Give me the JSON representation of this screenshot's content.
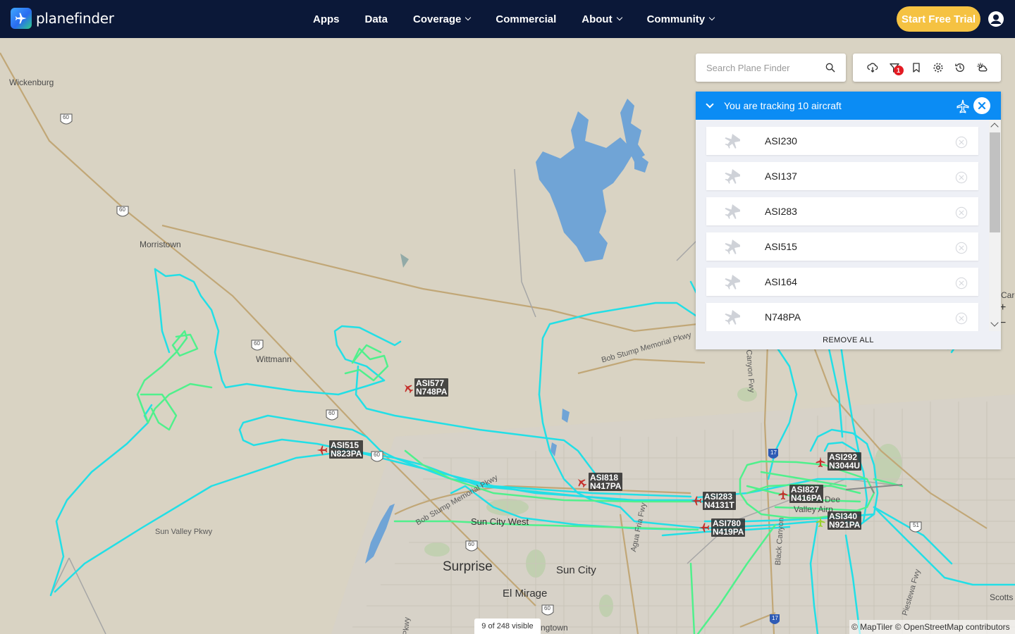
{
  "header": {
    "brand": "planefinder",
    "nav": [
      "Apps",
      "Data",
      "Coverage",
      "Commercial",
      "About",
      "Community"
    ],
    "trial_button": "Start Free Trial"
  },
  "search": {
    "placeholder": "Search Plane Finder"
  },
  "toolbar": {
    "icons": [
      "cloud-download-icon",
      "filter-icon",
      "bookmark-icon",
      "settings-icon",
      "history-icon",
      "weather-icon"
    ],
    "filter_badge": "1"
  },
  "tracking": {
    "title": "You are tracking 10 aircraft",
    "items": [
      "ASI230",
      "ASI137",
      "ASI283",
      "ASI515",
      "ASI164",
      "N748PA"
    ],
    "remove_all": "REMOVE ALL"
  },
  "map": {
    "places": {
      "wickenburg": "Wickenburg",
      "morristown": "Morristown",
      "wittmann": "Wittmann",
      "surprise": "Surprise",
      "sun_city_west": "Sun City West",
      "sun_city": "Sun City",
      "el_mirage": "El Mirage",
      "sun_valley_pkwy": "Sun Valley Pkwy",
      "bob_stump_pkwy": "Bob Stump Memorial Pkwy",
      "bob_stump_pkwy_2": "Bob Stump Memorial Pkwy",
      "agua_fria_fwy": "Agua Fria Fwy",
      "black_canyon": "Black Canyon",
      "canyon_fwy": "Canyon Fwy",
      "pkwy_vert": "Pkwy",
      "piestewa": "Piestewa Fwy",
      "valley_airport": "Valley Airp",
      "deer": "Dee",
      "ngtown": "ngtown",
      "care": "Care",
      "scotts": "Scotts",
      "rte60_a": "60",
      "rte60_b": "60",
      "rte60_c": "60",
      "rte60_d": "60",
      "rte60_e": "60",
      "rte60_f": "60",
      "rte60_g": "60",
      "rte17_a": "17",
      "rte17_b": "17",
      "rte51": "51"
    },
    "aircraft": [
      {
        "callsign": "ASI577",
        "reg": "N748PA",
        "color": "#c4302b"
      },
      {
        "callsign": "ASI515",
        "reg": "N823PA",
        "color": "#c4302b"
      },
      {
        "callsign": "ASI818",
        "reg": "N417PA",
        "color": "#c4302b"
      },
      {
        "callsign": "ASI283",
        "reg": "N4131T",
        "color": "#c4302b"
      },
      {
        "callsign": "ASI780",
        "reg": "N419PA",
        "color": "#c4302b"
      },
      {
        "callsign": "ASI292",
        "reg": "N3044U",
        "color": "#c4302b"
      },
      {
        "callsign": "ASI827",
        "reg": "N416PA",
        "color": "#c4302b"
      },
      {
        "callsign": "ASI340",
        "reg": "N921PA",
        "color": "#9bd12e"
      }
    ],
    "visible_count": "9 of 248 visible",
    "attribution": "© MapTiler © OpenStreetMap contributors"
  }
}
